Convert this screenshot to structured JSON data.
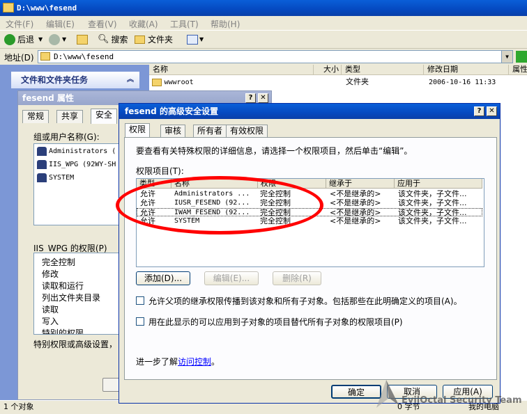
{
  "explorer": {
    "title": "D:\\www\\fesend",
    "menu": [
      "文件(F)",
      "编辑(E)",
      "查看(V)",
      "收藏(A)",
      "工具(T)",
      "帮助(H)"
    ],
    "toolbar": {
      "back": "后退",
      "search": "搜索",
      "folders": "文件夹"
    },
    "address_label": "地址(D)",
    "address_value": "D:\\www\\fesend",
    "task_pane_title": "文件和文件夹任务",
    "columns": [
      "名称",
      "大小",
      "类型",
      "修改日期",
      "属性"
    ],
    "files": [
      {
        "name": "wwwroot",
        "size": "",
        "type": "文件夹",
        "modified": "2006-10-16 11:33",
        "attrs": ""
      }
    ],
    "status_left": "1 个对象",
    "status_right_a": "0 字节",
    "status_right_b": "我的电脑"
  },
  "properties_dialog": {
    "title": "fesend 属性",
    "tabs": [
      "常规",
      "共享",
      "安全"
    ],
    "group_label": "组或用户名称(G):",
    "users": [
      "Administrators (",
      "IIS_WPG (92WY-SH",
      "SYSTEM"
    ],
    "perm_label": "IIS_WPG 的权限(P)",
    "permissions": [
      "完全控制",
      "修改",
      "读取和运行",
      "列出文件夹目录",
      "读取",
      "写入",
      "特别的权限"
    ],
    "special_text": "特别权限或高级设置，"
  },
  "advanced_dialog": {
    "title": "fesend 的高级安全设置",
    "tabs": [
      "权限",
      "审核",
      "所有者",
      "有效权限"
    ],
    "intro": "要查看有关特殊权限的详细信息，请选择一个权限项目，然后单击“编辑”。",
    "entries_label": "权限项目(T):",
    "table_headers": [
      "类型",
      "名称",
      "权限",
      "继承于",
      "应用于"
    ],
    "rows": [
      {
        "type": "允许",
        "name": "Administrators ...",
        "perm": "完全控制",
        "inherit": "<不是继承的>",
        "apply": "该文件夹，子文件..."
      },
      {
        "type": "允许",
        "name": "IUSR_FESEND (92...",
        "perm": "完全控制",
        "inherit": "<不是继承的>",
        "apply": "该文件夹，子文件..."
      },
      {
        "type": "允许",
        "name": "IWAM_FESEND (92...",
        "perm": "完全控制",
        "inherit": "<不是继承的>",
        "apply": "该文件夹，子文件..."
      },
      {
        "type": "允许",
        "name": "SYSTEM",
        "perm": "完全控制",
        "inherit": "<不是继承的>",
        "apply": "该文件夹，子文件..."
      }
    ],
    "btn_add": "添加(D)...",
    "btn_edit": "编辑(E)...",
    "btn_remove": "删除(R)",
    "check1": "允许父项的继承权限传播到该对象和所有子对象。包括那些在此明确定义的项目(A)。",
    "check2": "用在此显示的可以应用到子对象的项目替代所有子对象的权限项目(P)",
    "learn_prefix": "进一步了解",
    "learn_link": "访问控制",
    "learn_suffix": "。",
    "btn_ok": "确定",
    "btn_cancel": "取消",
    "btn_apply": "应用(A)",
    "help_btn": "?",
    "close_btn": "✕"
  },
  "watermark": "EvilOctal Security Team",
  "colors": {
    "annotation": "#ff0000",
    "xp_blue": "#0549c0"
  }
}
